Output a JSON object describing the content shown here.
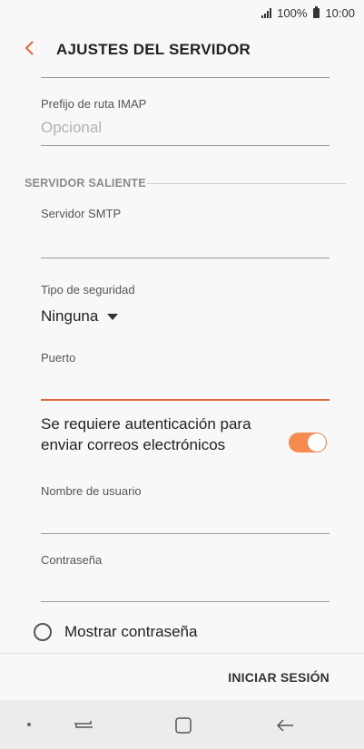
{
  "status": {
    "signal_label": "..ıl",
    "battery": "100%",
    "time": "10:00"
  },
  "header": {
    "title": "AJUSTES DEL SERVIDOR"
  },
  "form": {
    "imap_prefix": {
      "label": "Prefijo de ruta IMAP",
      "placeholder": "Opcional"
    },
    "outgoing_section": "SERVIDOR SALIENTE",
    "smtp_server": {
      "label": "Servidor SMTP",
      "value": ""
    },
    "security_type": {
      "label": "Tipo de seguridad",
      "selected": "Ninguna"
    },
    "port": {
      "label": "Puerto",
      "value": ""
    },
    "auth_required": {
      "label": "Se requiere autenticación para enviar correos electrónicos",
      "enabled": true
    },
    "username": {
      "label": "Nombre de usuario",
      "value": ""
    },
    "password": {
      "label": "Contraseña",
      "value": ""
    },
    "show_password": {
      "label": "Mostrar contraseña",
      "checked": false
    }
  },
  "actions": {
    "sign_in": "INICIAR SESIÓN"
  },
  "colors": {
    "accent": "#e0683d",
    "toggle_on": "#f58b4c"
  },
  "icons": {
    "back": "chevron-left-icon",
    "recent": "recent-apps-icon",
    "home": "home-icon",
    "nav_back": "back-arrow-icon"
  }
}
